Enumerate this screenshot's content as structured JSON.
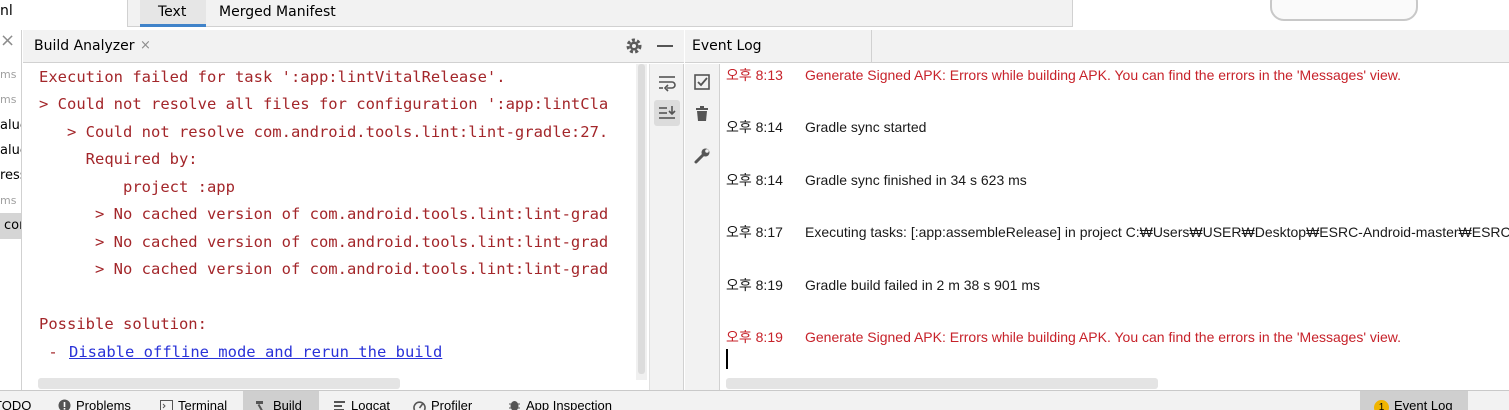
{
  "editor_tabs": {
    "left_fragment": "nl",
    "tabs": [
      "Text",
      "Merged Manifest"
    ]
  },
  "left_stub": {
    "lines": [
      "ms",
      "ms",
      "alue",
      "alue",
      "ress",
      "ms",
      "con"
    ]
  },
  "build_panel": {
    "title": "Build Analyzer",
    "close_glyph": "×",
    "lines": [
      "Execution failed for task ':app:lintVitalRelease'.",
      "> Could not resolve all files for configuration ':app:lintCla",
      "   > Could not resolve com.android.tools.lint:lint-gradle:27.",
      "     Required by:",
      "         project :app",
      "      > No cached version of com.android.tools.lint:lint-grad",
      "      > No cached version of com.android.tools.lint:lint-grad",
      "      > No cached version of com.android.tools.lint:lint-grad"
    ],
    "solution_heading": "Possible solution:",
    "solution_prefix": " - ",
    "solution_link": "Disable offline mode and rerun the build"
  },
  "event_log": {
    "title": "Event Log",
    "entries": [
      {
        "time": "오후 8:13",
        "message": "Generate Signed APK: Errors while building APK. You can find the errors in the 'Messages' view.",
        "level": "error"
      },
      {
        "time": "오후 8:14",
        "message": "Gradle sync started",
        "level": "info"
      },
      {
        "time": "오후 8:14",
        "message": "Gradle sync finished in 34 s 623 ms",
        "level": "info"
      },
      {
        "time": "오후 8:17",
        "message": "Executing tasks: [:app:assembleRelease] in project C:₩Users₩USER₩Desktop₩ESRC-Android-master₩ESRC-Android-master",
        "level": "info"
      },
      {
        "time": "오후 8:19",
        "message": "Gradle build failed in 2 m 38 s 901 ms",
        "level": "info"
      },
      {
        "time": "오후 8:19",
        "message": "Generate Signed APK: Errors while building APK. You can find the errors in the 'Messages' view.",
        "level": "error"
      }
    ]
  },
  "bottom_bar": {
    "items": [
      "TODO",
      "Problems",
      "Terminal",
      "Build",
      "Logcat",
      "Profiler",
      "App Inspection"
    ],
    "active": "Build",
    "event_log_badge": "1",
    "event_log_label": "Event Log"
  },
  "colors": {
    "error_text": "#c7222a",
    "console_error": "#a3262a",
    "link": "#2a33d8",
    "badge": "#f0b400",
    "active_tab_underline": "#4083c9"
  }
}
